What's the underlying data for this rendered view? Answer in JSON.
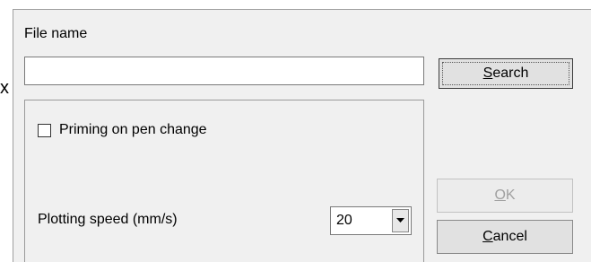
{
  "stray_text": "x",
  "file_name": {
    "label": "File name",
    "value": ""
  },
  "buttons": {
    "search": {
      "mnemonic": "S",
      "rest": "earch"
    },
    "ok": {
      "mnemonic": "O",
      "rest": "K",
      "enabled": false
    },
    "cancel": {
      "mnemonic": "C",
      "rest": "ancel"
    }
  },
  "priming": {
    "label": "Priming on pen change",
    "checked": false
  },
  "plotting_speed": {
    "label": "Plotting speed (mm/s)",
    "selected": "20"
  },
  "colors": {
    "dialog_bg": "#f0f0f0",
    "button_bg": "#e1e1e1",
    "disabled_text": "#a0a0a0"
  },
  "icons": {
    "dropdown": "chevron-down-icon"
  }
}
